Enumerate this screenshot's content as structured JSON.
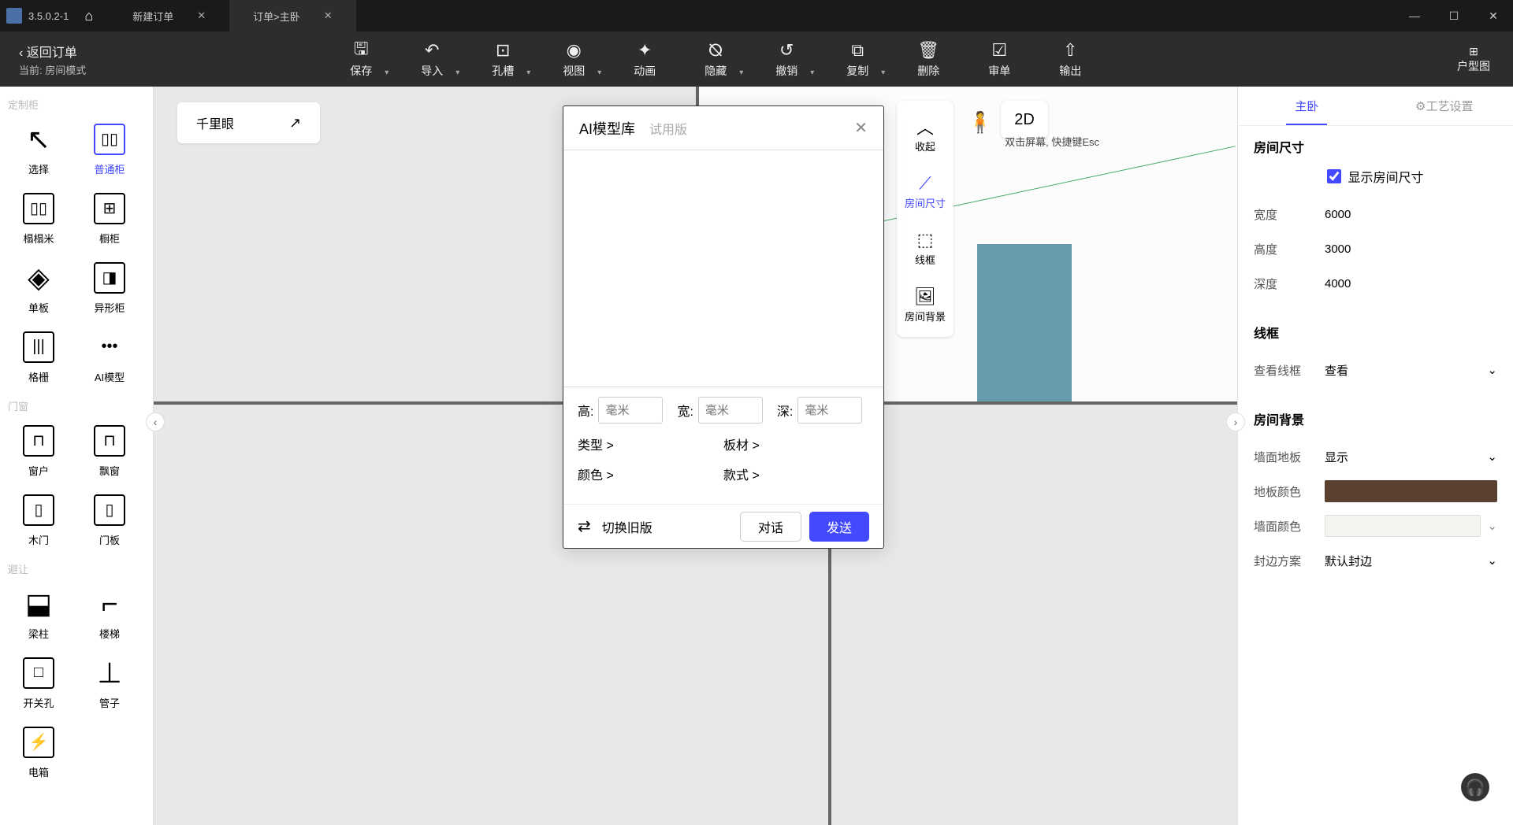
{
  "titlebar": {
    "version": "3.5.0.2-1",
    "tabs": [
      {
        "label": "新建订单"
      },
      {
        "label": "订单>主卧"
      }
    ]
  },
  "back": {
    "line1": "‹ 返回订单",
    "line2": "当前: 房间模式"
  },
  "toolbar": {
    "save": "保存",
    "import": "导入",
    "hole": "孔槽",
    "view": "视图",
    "anim": "动画",
    "hide": "隐藏",
    "undo": "撤销",
    "copy": "复制",
    "delete": "删除",
    "review": "审单",
    "export": "输出",
    "floorplan": "户型图"
  },
  "left": {
    "cat1": "定制柜",
    "select": "选择",
    "cabinet": "普通柜",
    "tatami": "榻榻米",
    "kitchen": "橱柜",
    "panel": "单板",
    "irregular": "异形柜",
    "grid": "格栅",
    "ai": "AI模型",
    "cat2": "门窗",
    "window": "窗户",
    "bay": "飘窗",
    "door": "木门",
    "doorpanel": "门板",
    "cat3": "避让",
    "beam": "梁柱",
    "stairs": "楼梯",
    "switch": "开关孔",
    "pipe": "管子",
    "ebox": "电箱"
  },
  "canvas": {
    "qianli": "千里眼",
    "btn2d": "2D",
    "hint": "双击屏幕, 快捷键Esc"
  },
  "float": {
    "collapse": "收起",
    "roomsize": "房间尺寸",
    "wireframe": "线框",
    "roombg": "房间背景"
  },
  "right": {
    "tab1": "主卧",
    "tab2": "工艺设置",
    "sec_room": "房间尺寸",
    "show_room": "显示房间尺寸",
    "width_l": "宽度",
    "width_v": "6000",
    "height_l": "高度",
    "height_v": "3000",
    "depth_l": "深度",
    "depth_v": "4000",
    "sec_wire": "线框",
    "viewwire_l": "查看线框",
    "viewwire_v": "查看",
    "sec_bg": "房间背景",
    "wallfloor_l": "墙面地板",
    "wallfloor_v": "显示",
    "floorcolor_l": "地板颜色",
    "wallcolor_l": "墙面颜色",
    "edge_l": "封边方案",
    "edge_v": "默认封边"
  },
  "modal": {
    "title": "AI模型库",
    "sub": "试用版",
    "h": "高:",
    "w": "宽:",
    "d": "深:",
    "ph": "毫米",
    "type": "类型 >",
    "board": "板材 >",
    "color": "颜色 >",
    "style": "款式 >",
    "switch": "切换旧版",
    "chat": "对话",
    "send": "发送"
  },
  "colors": {
    "floor": "#5a4030",
    "wall": "#f5f4f0"
  }
}
